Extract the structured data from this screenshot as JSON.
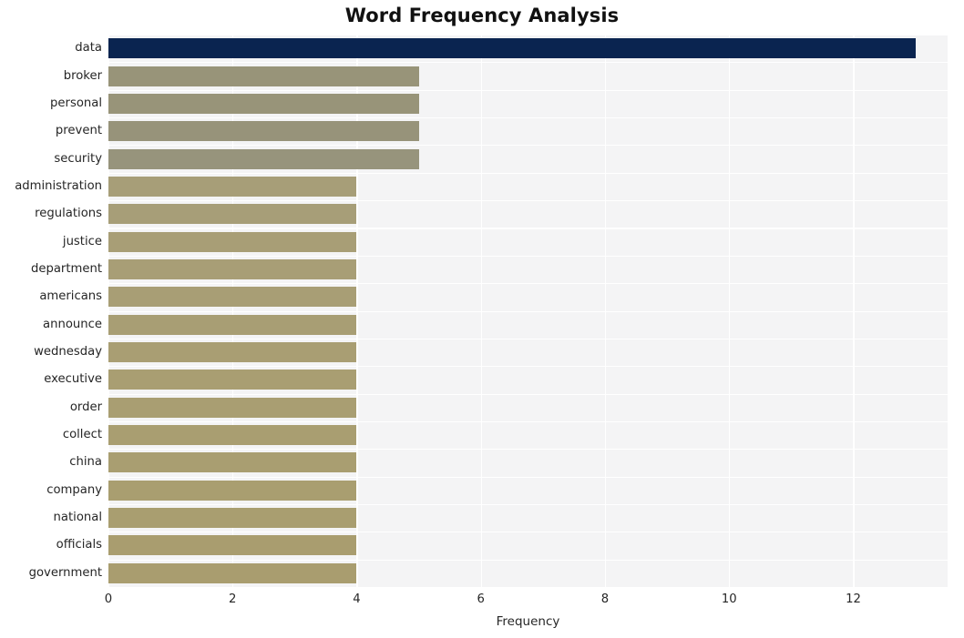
{
  "chart_data": {
    "type": "bar",
    "orientation": "horizontal",
    "title": "Word Frequency Analysis",
    "xlabel": "Frequency",
    "ylabel": "",
    "categories": [
      "data",
      "broker",
      "personal",
      "prevent",
      "security",
      "administration",
      "regulations",
      "justice",
      "department",
      "americans",
      "announce",
      "wednesday",
      "executive",
      "order",
      "collect",
      "china",
      "company",
      "national",
      "officials",
      "government"
    ],
    "values": [
      13,
      5,
      5,
      5,
      5,
      4,
      4,
      4,
      4,
      4,
      4,
      4,
      4,
      4,
      4,
      4,
      4,
      4,
      4,
      4
    ],
    "bar_colors": [
      "#0a2450",
      "#989479",
      "#989479",
      "#97937a",
      "#97947c",
      "#a79e78",
      "#a79e78",
      "#a89e76",
      "#a89e76",
      "#a89e75",
      "#a89e74",
      "#a99e73",
      "#a99e72",
      "#a99e72",
      "#a99e71",
      "#a99e71",
      "#a99e70",
      "#a99e70",
      "#a99d6f",
      "#a99d6f"
    ],
    "xticks": [
      0,
      2,
      4,
      6,
      8,
      10,
      12
    ],
    "xtick_labels": [
      "0",
      "2",
      "4",
      "6",
      "8",
      "10",
      "12"
    ],
    "xlim": [
      0,
      13.52
    ],
    "grid": true,
    "grid_color": "#ffffff",
    "plot_background": "#f4f4f5",
    "figure_background": "#ffffff",
    "legend": null,
    "style": "seaborn-darkgrid"
  }
}
